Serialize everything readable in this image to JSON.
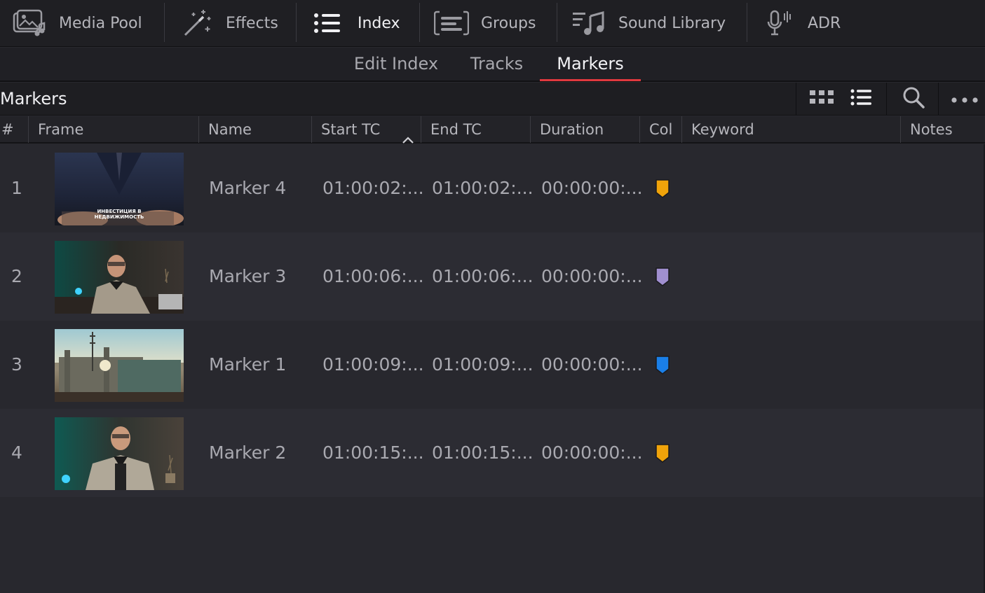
{
  "toolbar": {
    "items": [
      {
        "label": "Media Pool",
        "icon": "media-pool-icon"
      },
      {
        "label": "Effects",
        "icon": "effects-wand-icon"
      },
      {
        "label": "Index",
        "icon": "list-icon",
        "active": true
      },
      {
        "label": "Groups",
        "icon": "groups-icon"
      },
      {
        "label": "Sound Library",
        "icon": "sound-library-icon"
      },
      {
        "label": "ADR",
        "icon": "microphone-icon"
      }
    ]
  },
  "subtabs": {
    "items": [
      {
        "label": "Edit Index"
      },
      {
        "label": "Tracks"
      },
      {
        "label": "Markers",
        "active": true
      }
    ],
    "accent_color": "#e0393e"
  },
  "panel": {
    "title": "Markers",
    "buttons": [
      "grid-view-icon",
      "list-view-icon",
      "search-icon",
      "more-options-icon"
    ]
  },
  "table": {
    "columns": [
      {
        "label": "#"
      },
      {
        "label": "Frame"
      },
      {
        "label": "Name"
      },
      {
        "label": "Start TC",
        "sorted": "ascending"
      },
      {
        "label": "End TC"
      },
      {
        "label": "Duration"
      },
      {
        "label": "Col"
      },
      {
        "label": "Keyword"
      },
      {
        "label": "Notes"
      }
    ],
    "rows": [
      {
        "num": "1",
        "frame": "suit-hands-caption",
        "caption_line1": "ИНВЕСТИЦИЯ В",
        "caption_line2": "НЕДВИЖИМОСТЬ",
        "name": "Marker 4",
        "start": "01:00:02:...",
        "end": "01:00:02:...",
        "duration": "00:00:00:...",
        "color": "#f0a30a"
      },
      {
        "num": "2",
        "frame": "man-at-desk",
        "name": "Marker 3",
        "start": "01:00:06:...",
        "end": "01:00:06:...",
        "duration": "00:00:00:...",
        "color": "#a08fd0"
      },
      {
        "num": "3",
        "frame": "building-construction",
        "name": "Marker 1",
        "start": "01:00:09:...",
        "end": "01:00:09:...",
        "duration": "00:00:00:...",
        "color": "#1a7fe8"
      },
      {
        "num": "4",
        "frame": "man-portrait",
        "name": "Marker 2",
        "start": "01:00:15:...",
        "end": "01:00:15:...",
        "duration": "00:00:00:...",
        "color": "#f0a30a"
      }
    ]
  }
}
